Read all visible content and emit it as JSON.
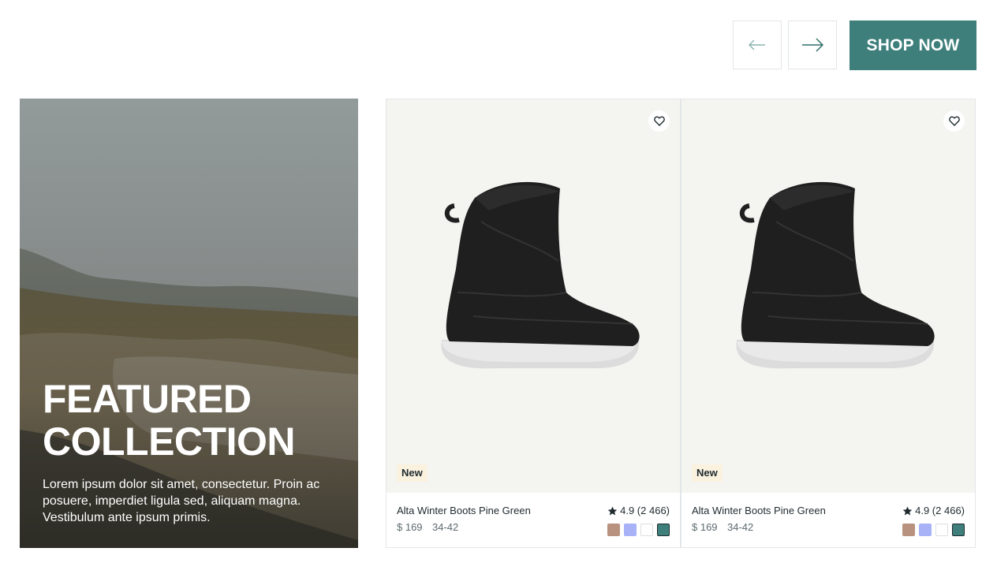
{
  "header": {
    "prev_label": "previous",
    "next_label": "next",
    "shop_now": "SHOP NOW"
  },
  "featured": {
    "title_line1": "FEATURED",
    "title_line2": "COLLECTION",
    "description": "Lorem ipsum dolor sit amet, consectetur. Proin ac posuere, imperdiet ligula sed, aliquam magna. Vestibulum ante ipsum primis."
  },
  "products": [
    {
      "badge": "New",
      "name": "Alta Winter Boots Pine Green",
      "rating": "4.9 (2 466)",
      "price": "$ 169",
      "sizes": "34-42",
      "swatches": [
        "#b8927f",
        "#a7b2f7",
        "#ffffff",
        "#3f7f7b"
      ]
    },
    {
      "badge": "New",
      "name": "Alta Winter Boots Pine Green",
      "rating": "4.9 (2 466)",
      "price": "$ 169",
      "sizes": "34-42",
      "swatches": [
        "#b8927f",
        "#a7b2f7",
        "#ffffff",
        "#3f7f7b"
      ]
    }
  ],
  "colors": {
    "accent": "#3e7f7b",
    "badge_bg": "#fbf1df",
    "card_bg": "#f4f4f1"
  }
}
